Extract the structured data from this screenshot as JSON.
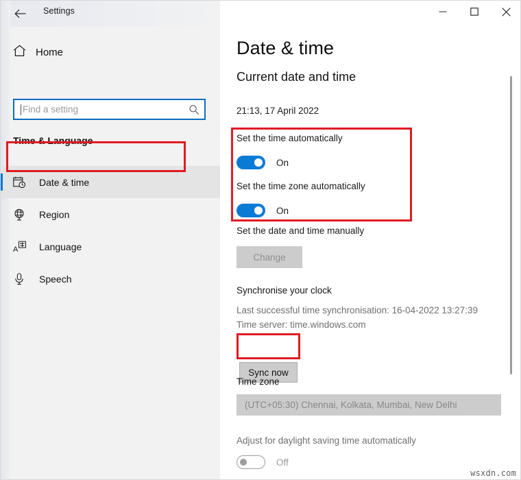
{
  "window": {
    "title": "Settings",
    "back_icon": "back-arrow-icon",
    "minimize_icon": "minimize-icon",
    "maximize_icon": "maximize-icon",
    "close_icon": "close-icon"
  },
  "sidebar": {
    "home_label": "Home",
    "home_icon": "home-icon",
    "search": {
      "placeholder": "Find a setting",
      "value": "",
      "icon": "search-icon"
    },
    "group_title": "Time & Language",
    "items": [
      {
        "label": "Date & time",
        "icon": "calendar-clock-icon",
        "selected": true
      },
      {
        "label": "Region",
        "icon": "globe-icon",
        "selected": false
      },
      {
        "label": "Language",
        "icon": "language-icon",
        "selected": false
      },
      {
        "label": "Speech",
        "icon": "microphone-icon",
        "selected": false
      }
    ]
  },
  "main": {
    "page_title": "Date & time",
    "current_section": {
      "heading": "Current date and time",
      "now": "21:13, 17 April 2022"
    },
    "auto_time": {
      "label": "Set the time automatically",
      "state": "On",
      "on": true
    },
    "auto_timezone": {
      "label": "Set the time zone automatically",
      "state": "On",
      "on": true
    },
    "manual": {
      "label": "Set the date and time manually",
      "button": "Change",
      "disabled": true
    },
    "sync": {
      "heading": "Synchronise your clock",
      "last_sync": "Last successful time synchronisation: 16-04-2022 13:27:39",
      "time_server": "Time server: time.windows.com",
      "button": "Sync now"
    },
    "timezone": {
      "heading": "Time zone",
      "selected": "(UTC+05:30) Chennai, Kolkata, Mumbai, New Delhi"
    },
    "dst": {
      "label": "Adjust for daylight saving time automatically",
      "state": "Off",
      "on": false
    }
  },
  "annotations": {
    "highlight_color": "#e01a23",
    "boxes": [
      "date-time-nav-item",
      "automatic-time-toggles",
      "sync-now-button"
    ]
  },
  "watermark": "wsxdn.com"
}
